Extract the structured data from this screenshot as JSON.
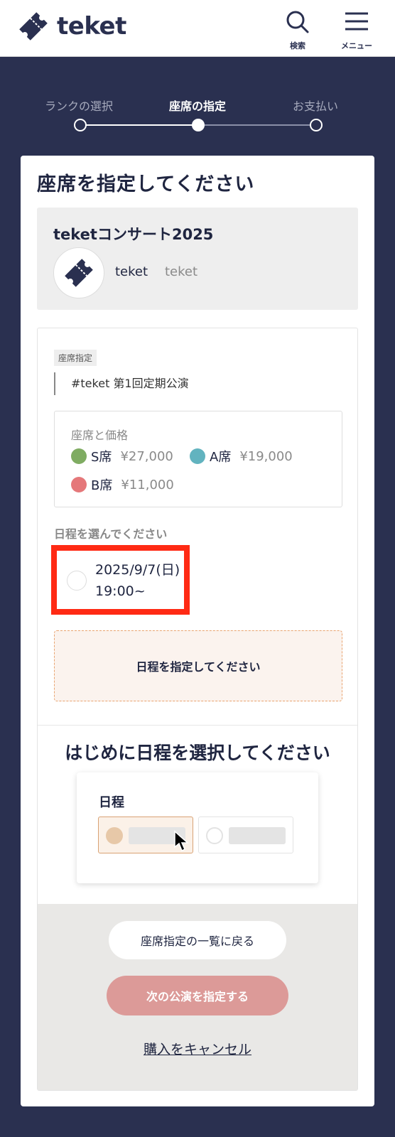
{
  "header": {
    "brand": "teket",
    "search_label": "検索",
    "menu_label": "メニュー"
  },
  "steps": [
    {
      "label": "ランクの選択",
      "state": "done"
    },
    {
      "label": "座席の指定",
      "state": "current"
    },
    {
      "label": "お支払い",
      "state": "todo"
    }
  ],
  "page": {
    "title": "座席を指定してください"
  },
  "event": {
    "title": "teketコンサート2025",
    "organizer_name": "teket",
    "organizer_id": "teket"
  },
  "performance": {
    "tag": "座席指定",
    "name": "#teket 第1回定期公演"
  },
  "prices": {
    "title": "座席と価格",
    "items": [
      {
        "seat": "S席",
        "price": "¥27,000",
        "color": "#7fac62"
      },
      {
        "seat": "A席",
        "price": "¥19,000",
        "color": "#62b3bf"
      },
      {
        "seat": "B席",
        "price": "¥11,000",
        "color": "#e5787a"
      }
    ]
  },
  "date": {
    "prompt": "日程を選んでください",
    "option": "2025/9/7(日) 19:00~",
    "notice": "日程を指定してください"
  },
  "guide": {
    "title": "はじめに日程を選択してください",
    "label": "日程"
  },
  "actions": {
    "back": "座席指定の一覧に戻る",
    "next": "次の公演を指定する",
    "cancel": "購入をキャンセル"
  },
  "colors": {
    "navy": "#2a3050",
    "highlight": "#ff2a14",
    "next_button": "#dc9a98"
  }
}
